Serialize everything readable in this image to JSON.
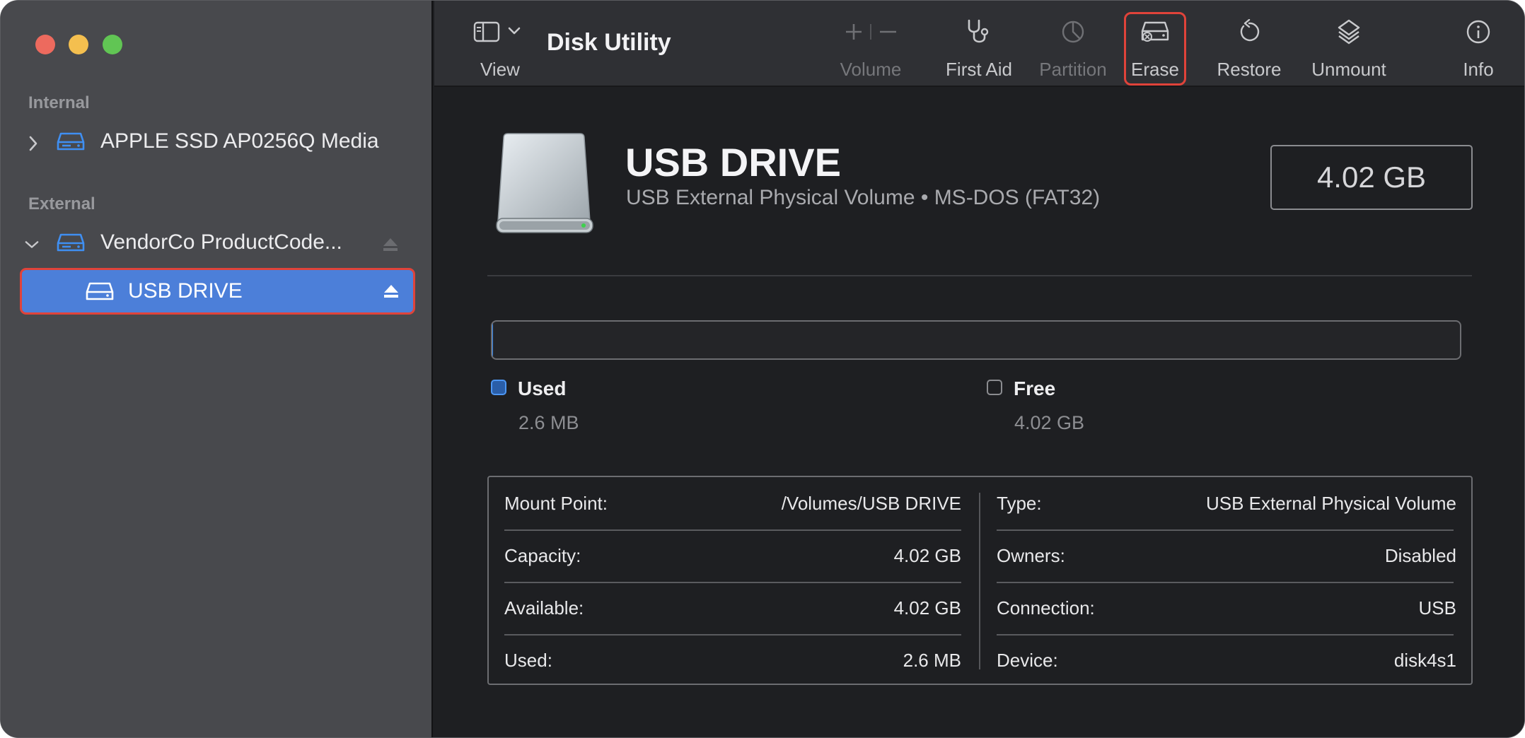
{
  "window": {
    "title": "Disk Utility"
  },
  "sidebar": {
    "sections": [
      {
        "label": "Internal"
      },
      {
        "label": "External"
      }
    ],
    "items": [
      {
        "label": "APPLE SSD AP0256Q Media",
        "expanded": false
      },
      {
        "label": "VendorCo ProductCode...",
        "expanded": true
      },
      {
        "label": "USB DRIVE",
        "selected": true
      }
    ]
  },
  "toolbar": {
    "view_label": "View",
    "buttons": [
      {
        "label": "Volume",
        "icon": "plus-minus-icon",
        "enabled": false
      },
      {
        "label": "First Aid",
        "icon": "stethoscope-icon",
        "enabled": true
      },
      {
        "label": "Partition",
        "icon": "pie-icon",
        "enabled": false
      },
      {
        "label": "Erase",
        "icon": "erase-disk-icon",
        "enabled": true,
        "highlighted": true
      },
      {
        "label": "Restore",
        "icon": "restore-icon",
        "enabled": true
      },
      {
        "label": "Unmount",
        "icon": "unmount-icon",
        "enabled": true
      },
      {
        "label": "Info",
        "icon": "info-icon",
        "enabled": true
      }
    ]
  },
  "volume": {
    "name": "USB DRIVE",
    "subtitle": "USB External Physical Volume • MS-DOS (FAT32)",
    "capacity": "4.02 GB",
    "used_fraction": 0.0006
  },
  "usage": {
    "used_label": "Used",
    "used_value": "2.6 MB",
    "free_label": "Free",
    "free_value": "4.02 GB"
  },
  "info": {
    "left": [
      {
        "key": "Mount Point:",
        "value": "/Volumes/USB DRIVE"
      },
      {
        "key": "Capacity:",
        "value": "4.02 GB"
      },
      {
        "key": "Available:",
        "value": "4.02 GB"
      },
      {
        "key": "Used:",
        "value": "2.6 MB"
      }
    ],
    "right": [
      {
        "key": "Type:",
        "value": "USB External Physical Volume"
      },
      {
        "key": "Owners:",
        "value": "Disabled"
      },
      {
        "key": "Connection:",
        "value": "USB"
      },
      {
        "key": "Device:",
        "value": "disk4s1"
      }
    ]
  },
  "colors": {
    "accent": "#4c7fd9",
    "highlight_border": "#e0433a",
    "used_blue": "#3c8cf0"
  }
}
